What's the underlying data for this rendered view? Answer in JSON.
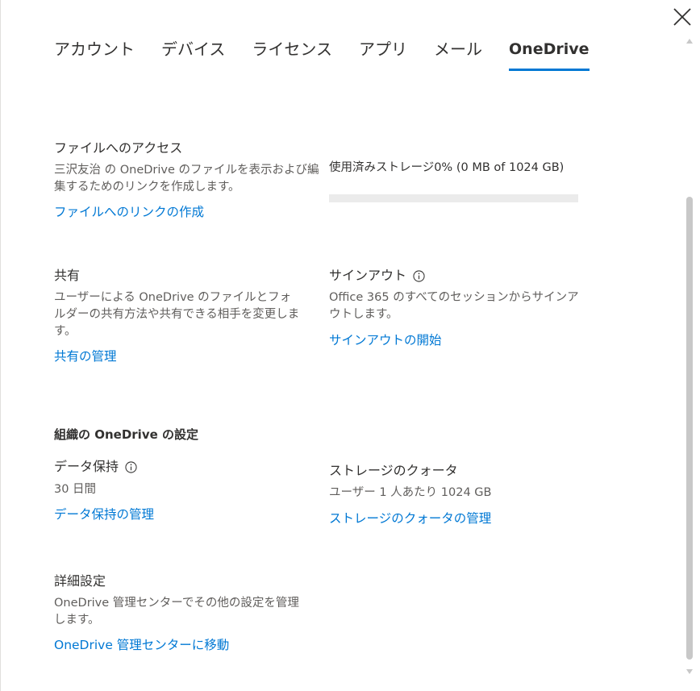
{
  "tabs": [
    {
      "label": "アカウント",
      "active": false
    },
    {
      "label": "デバイス",
      "active": false
    },
    {
      "label": "ライセンス",
      "active": false
    },
    {
      "label": "アプリ",
      "active": false
    },
    {
      "label": "メール",
      "active": false
    },
    {
      "label": "OneDrive",
      "active": true
    }
  ],
  "file_access": {
    "heading": "ファイルへのアクセス",
    "description": "三沢友治 の OneDrive のファイルを表示および編集するためのリンクを作成します。",
    "link": "ファイルへのリンクの作成"
  },
  "storage": {
    "label": "使用済みストレージ0% (0 MB of 1024 GB)",
    "used_percent": 0
  },
  "sharing": {
    "heading": "共有",
    "description": "ユーザーによる OneDrive のファイルとフォルダーの共有方法や共有できる相手を変更します。",
    "link": "共有の管理"
  },
  "sign_out": {
    "heading": "サインアウト",
    "description": "Office 365 のすべてのセッションからサインアウトします。",
    "link": "サインアウトの開始"
  },
  "org_settings": {
    "heading": "組織の OneDrive の設定"
  },
  "retention": {
    "heading": "データ保持",
    "value": "30 日間",
    "link": "データ保持の管理"
  },
  "quota": {
    "heading": "ストレージのクォータ",
    "value": "ユーザー 1 人あたり 1024 GB",
    "link": "ストレージのクォータの管理"
  },
  "advanced": {
    "heading": "詳細設定",
    "description": "OneDrive 管理センターでその他の設定を管理します。",
    "link": "OneDrive 管理センターに移動"
  },
  "icons": {
    "close": "close-icon",
    "info": "info-icon",
    "scroll_up": "chevron-up-icon",
    "scroll_down": "chevron-down-icon"
  },
  "colors": {
    "accent": "#0078d4",
    "text": "#323130",
    "secondary_text": "#605e5c",
    "bar_track": "#ebebeb"
  }
}
